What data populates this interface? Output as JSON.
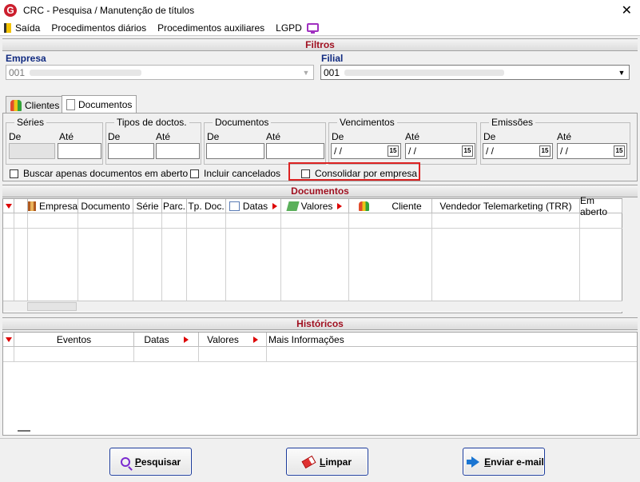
{
  "window": {
    "title": "CRC - Pesquisa / Manutenção de títulos",
    "close_glyph": "✕",
    "logo_letter": "G"
  },
  "menu": {
    "items": [
      "Saída",
      "Procedimentos diários",
      "Procedimentos auxiliares",
      "LGPD"
    ]
  },
  "filters": {
    "header": "Filtros",
    "empresa_label": "Empresa",
    "empresa_value": "001",
    "filial_label": "Filial",
    "filial_value": "001",
    "tabs": [
      "Clientes",
      "Documentos"
    ],
    "active_tab": "Documentos",
    "groups": {
      "series": {
        "legend": "Séries",
        "from": "De",
        "to": "Até"
      },
      "tipos": {
        "legend": "Tipos de doctos.",
        "from": "De",
        "to": "Até"
      },
      "documentos": {
        "legend": "Documentos",
        "from": "De",
        "to": "Até"
      },
      "vencimentos": {
        "legend": "Vencimentos",
        "from": "De",
        "to": "Até",
        "from_value": " /  /",
        "to_value": " /  /"
      },
      "emissoes": {
        "legend": "Emissões",
        "from": "De",
        "to": "Até",
        "from_value": " /  /",
        "to_value": " /  /"
      }
    },
    "cal_glyph": "15",
    "checkboxes": {
      "abertos": "Buscar apenas documentos em aberto",
      "cancelados": "Incluir cancelados",
      "consolidar": "Consolidar por empresa"
    }
  },
  "documents": {
    "header": "Documentos",
    "columns": [
      "Empresa",
      "Documento",
      "Série",
      "Parc.",
      "Tp. Doc.",
      "Datas",
      "Valores",
      "Cliente",
      "Vendedor Telemarketing (TRR)",
      "Em aberto"
    ]
  },
  "history": {
    "header": "Históricos",
    "columns": [
      "Eventos",
      "Datas",
      "Valores",
      "Mais Informações"
    ]
  },
  "buttons": {
    "search": {
      "u": "P",
      "rest": "esquisar"
    },
    "clear": {
      "u": "L",
      "rest": "impar"
    },
    "email": {
      "u": "E",
      "rest": "nviar e-mail"
    }
  }
}
